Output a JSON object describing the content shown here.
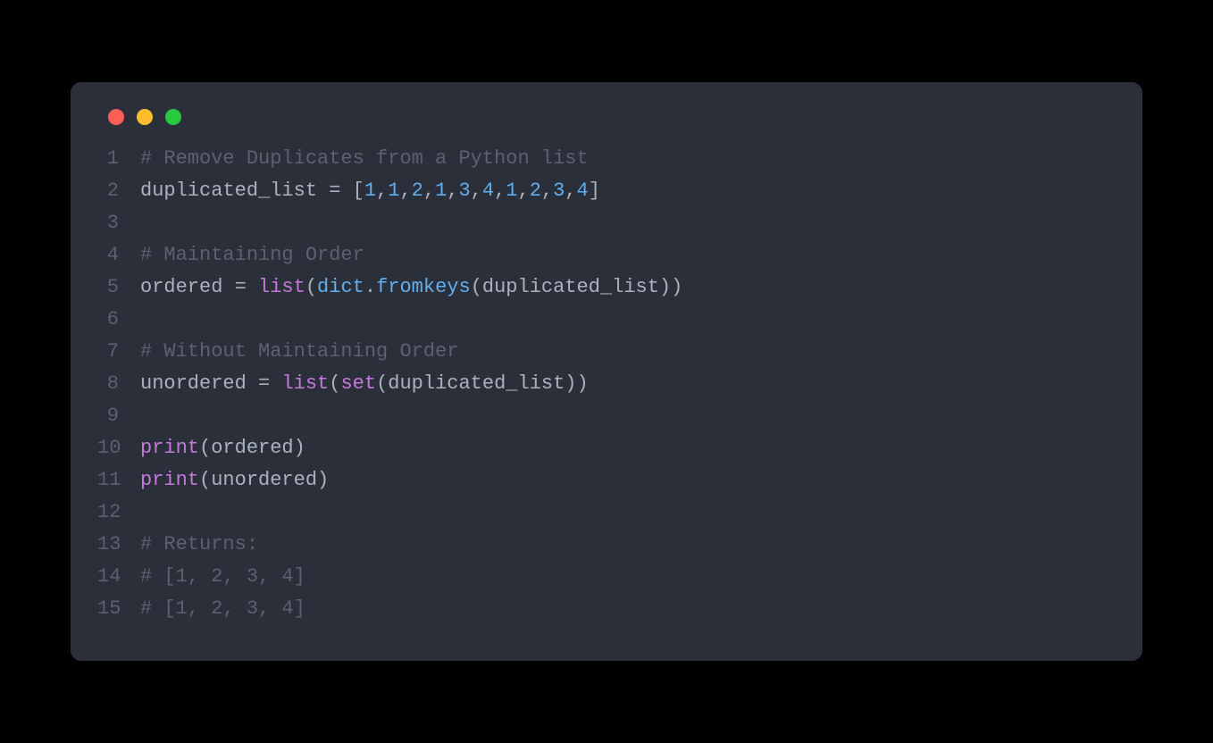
{
  "traffic_lights": {
    "red": "#ff5f56",
    "yellow": "#ffbd2e",
    "green": "#27c93f"
  },
  "code": {
    "lines": [
      {
        "n": "1",
        "tokens": [
          {
            "t": "# Remove Duplicates from a Python list",
            "c": "comment"
          }
        ]
      },
      {
        "n": "2",
        "tokens": [
          {
            "t": "duplicated_list ",
            "c": "identifier"
          },
          {
            "t": "= ",
            "c": "operator"
          },
          {
            "t": "[",
            "c": "punct"
          },
          {
            "t": "1",
            "c": "number"
          },
          {
            "t": ",",
            "c": "punct"
          },
          {
            "t": "1",
            "c": "number"
          },
          {
            "t": ",",
            "c": "punct"
          },
          {
            "t": "2",
            "c": "number"
          },
          {
            "t": ",",
            "c": "punct"
          },
          {
            "t": "1",
            "c": "number"
          },
          {
            "t": ",",
            "c": "punct"
          },
          {
            "t": "3",
            "c": "number"
          },
          {
            "t": ",",
            "c": "punct"
          },
          {
            "t": "4",
            "c": "number"
          },
          {
            "t": ",",
            "c": "punct"
          },
          {
            "t": "1",
            "c": "number"
          },
          {
            "t": ",",
            "c": "punct"
          },
          {
            "t": "2",
            "c": "number"
          },
          {
            "t": ",",
            "c": "punct"
          },
          {
            "t": "3",
            "c": "number"
          },
          {
            "t": ",",
            "c": "punct"
          },
          {
            "t": "4",
            "c": "number"
          },
          {
            "t": "]",
            "c": "punct"
          }
        ]
      },
      {
        "n": "3",
        "tokens": []
      },
      {
        "n": "4",
        "tokens": [
          {
            "t": "# Maintaining Order",
            "c": "comment"
          }
        ]
      },
      {
        "n": "5",
        "tokens": [
          {
            "t": "ordered ",
            "c": "identifier"
          },
          {
            "t": "= ",
            "c": "operator"
          },
          {
            "t": "list",
            "c": "keyword"
          },
          {
            "t": "(",
            "c": "punct"
          },
          {
            "t": "dict",
            "c": "builtin"
          },
          {
            "t": ".",
            "c": "punct"
          },
          {
            "t": "fromkeys",
            "c": "method"
          },
          {
            "t": "(duplicated_list))",
            "c": "punct"
          }
        ]
      },
      {
        "n": "6",
        "tokens": []
      },
      {
        "n": "7",
        "tokens": [
          {
            "t": "# Without Maintaining Order",
            "c": "comment"
          }
        ]
      },
      {
        "n": "8",
        "tokens": [
          {
            "t": "unordered ",
            "c": "identifier"
          },
          {
            "t": "= ",
            "c": "operator"
          },
          {
            "t": "list",
            "c": "keyword"
          },
          {
            "t": "(",
            "c": "punct"
          },
          {
            "t": "set",
            "c": "keyword"
          },
          {
            "t": "(duplicated_list))",
            "c": "punct"
          }
        ]
      },
      {
        "n": "9",
        "tokens": []
      },
      {
        "n": "10",
        "tokens": [
          {
            "t": "print",
            "c": "keyword"
          },
          {
            "t": "(ordered)",
            "c": "punct"
          }
        ]
      },
      {
        "n": "11",
        "tokens": [
          {
            "t": "print",
            "c": "keyword"
          },
          {
            "t": "(unordered)",
            "c": "punct"
          }
        ]
      },
      {
        "n": "12",
        "tokens": []
      },
      {
        "n": "13",
        "tokens": [
          {
            "t": "# Returns:",
            "c": "comment"
          }
        ]
      },
      {
        "n": "14",
        "tokens": [
          {
            "t": "# [1, 2, 3, 4]",
            "c": "comment"
          }
        ]
      },
      {
        "n": "15",
        "tokens": [
          {
            "t": "# [1, 2, 3, 4]",
            "c": "comment"
          }
        ]
      }
    ]
  }
}
